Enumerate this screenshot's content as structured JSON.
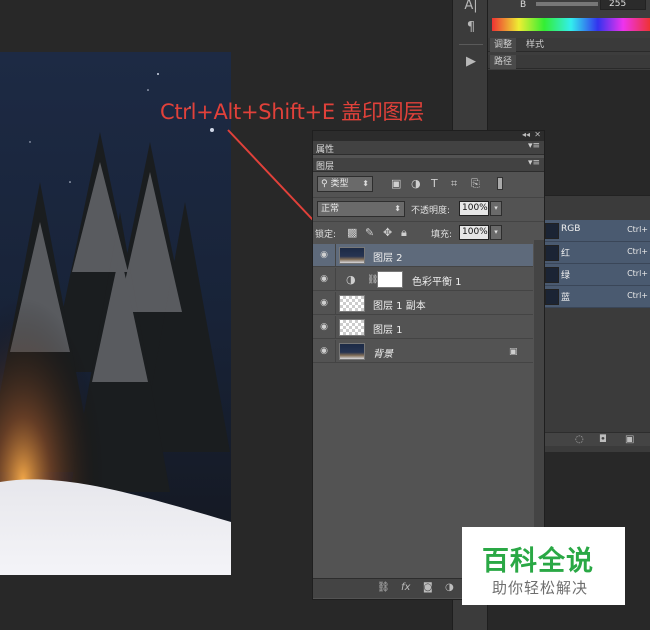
{
  "annotation": {
    "text": "Ctrl+Alt+Shift+E 盖印图层",
    "color": "#e1413a"
  },
  "top_panel": {
    "gradient_letter": "B",
    "value": "255",
    "tabs": [
      "调整",
      "样式"
    ],
    "paths_tab": "路径"
  },
  "dock": {
    "icons": [
      "type-settings-icon",
      "paragraph-icon",
      "play-icon"
    ]
  },
  "layers_panel": {
    "properties_tab": "属性",
    "layers_tab": "图层",
    "filter_kind": "类型",
    "blend_mode": "正常",
    "opacity_label": "不透明度:",
    "opacity_value": "100%",
    "lock_label": "锁定:",
    "fill_label": "填充:",
    "fill_value": "100%",
    "layers": [
      {
        "name": "图层 2",
        "selected": true,
        "thumb": "night"
      },
      {
        "name": "色彩平衡 1",
        "selected": false,
        "thumb": "adjustment"
      },
      {
        "name": "图层 1 副本",
        "selected": false,
        "thumb": "checker"
      },
      {
        "name": "图层 1",
        "selected": false,
        "thumb": "checker"
      },
      {
        "name": "背景",
        "selected": false,
        "thumb": "night",
        "locked": true
      }
    ]
  },
  "channels": [
    {
      "name": "RGB",
      "shortcut": "Ctrl+"
    },
    {
      "name": "红",
      "shortcut": "Ctrl+"
    },
    {
      "name": "绿",
      "shortcut": "Ctrl+"
    },
    {
      "name": "蓝",
      "shortcut": "Ctrl+"
    }
  ],
  "logo": {
    "main": "百科全说",
    "sub": "助你轻松解决",
    "color": "#2aa845"
  }
}
